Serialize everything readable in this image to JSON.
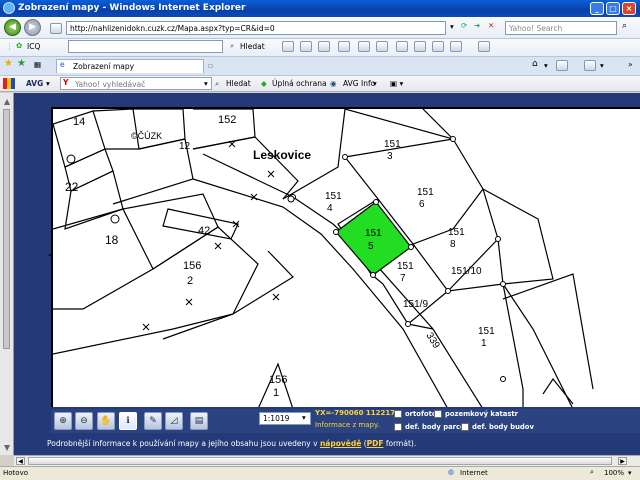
{
  "window": {
    "title": "Zobrazení mapy - Windows Internet Explorer",
    "min": "_",
    "max": "□",
    "close": "×"
  },
  "address": {
    "url": "http://nahlizenidokn.cuzk.cz/Mapa.aspx?typ=CR&id=0",
    "search_placeholder": "Yahoo! Search"
  },
  "links_bar": {
    "icq": "ICQ",
    "hledat": "Hledat"
  },
  "tab": {
    "label": "Zobrazení mapy"
  },
  "avg_bar": {
    "avg": "AVG",
    "yahoo_placeholder": "Yahoo! vyhledávač",
    "hledat": "Hledat",
    "ochrana": "Úplná ochrana",
    "avginfo": "AVG Info"
  },
  "map": {
    "copyright": "©ČÚZK",
    "locality": "Leskovice",
    "highlight_color": "#22dd22",
    "parcels": [
      {
        "num": "14"
      },
      {
        "num": "152"
      },
      {
        "num": "12"
      },
      {
        "num": "22"
      },
      {
        "num": "42"
      },
      {
        "num": "18"
      },
      {
        "num": "156",
        "sub": "2"
      },
      {
        "num": "151",
        "sub": "3"
      },
      {
        "num": "151",
        "sub": "4"
      },
      {
        "num": "151",
        "sub": "5"
      },
      {
        "num": "151",
        "sub": "6"
      },
      {
        "num": "151",
        "sub": "8"
      },
      {
        "num": "151",
        "sub": "7"
      },
      {
        "num": "151/10"
      },
      {
        "num": "151/9"
      },
      {
        "num": "151",
        "sub": "1"
      },
      {
        "num": "339"
      },
      {
        "num": "156",
        "sub": "1"
      }
    ]
  },
  "toolbar": {
    "scale": "1:1019",
    "coords": "YX=-790060 1122177",
    "info_link": "Informace z mapy.",
    "checks": {
      "ortofoto": "ortofoto",
      "katastr": "pozemkový katastr",
      "parcely": "def. body parcel",
      "budovy": "def. body budov"
    },
    "icons": [
      "zoom-in-icon",
      "zoom-out-icon",
      "pan-hand-icon",
      "info-icon",
      "ruler-icon",
      "measure-area-icon",
      "print-icon"
    ]
  },
  "note": {
    "before": "Podrobnější informace k používání mapy a jejího obsahu jsou uvedeny v ",
    "link1": "nápovědě",
    "mid": " (",
    "link2": "PDF",
    "after": " formát)."
  },
  "status": {
    "left": "Hotovo",
    "zone": "Internet",
    "zoom": "100%"
  }
}
